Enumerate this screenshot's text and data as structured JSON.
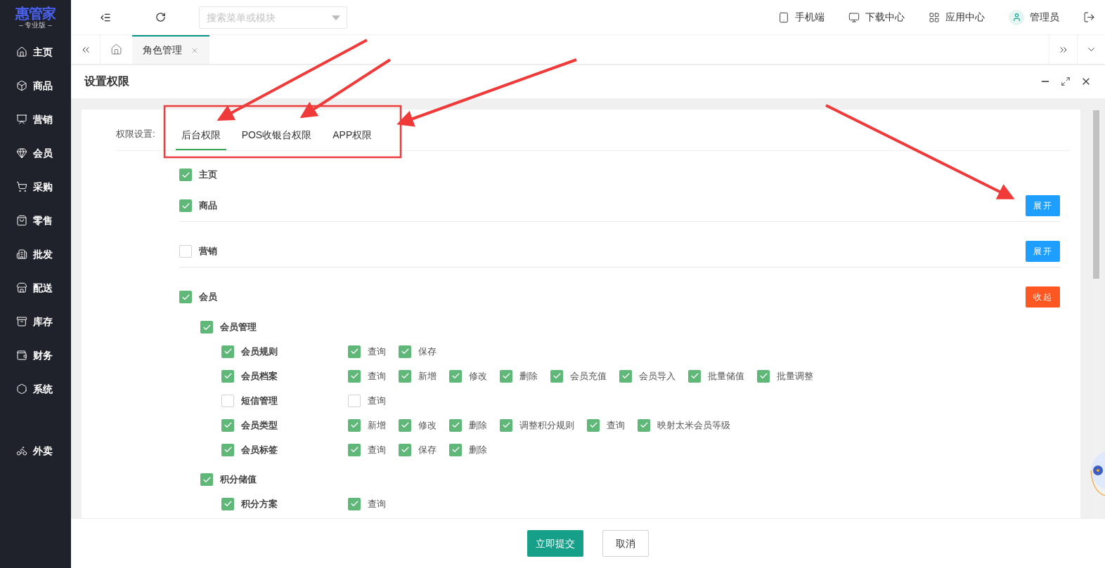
{
  "brand": {
    "name": "惠管家",
    "edition": "– 专业版 –"
  },
  "sidebar": {
    "items": [
      {
        "label": "主页"
      },
      {
        "label": "商品"
      },
      {
        "label": "营销"
      },
      {
        "label": "会员"
      },
      {
        "label": "采购"
      },
      {
        "label": "零售"
      },
      {
        "label": "批发"
      },
      {
        "label": "配送"
      },
      {
        "label": "库存"
      },
      {
        "label": "财务"
      },
      {
        "label": "系统"
      },
      {
        "label": "外卖"
      }
    ]
  },
  "header": {
    "search": {
      "placeholder": "搜索菜单或模块"
    },
    "links": [
      {
        "label": "手机端"
      },
      {
        "label": "下载中心"
      },
      {
        "label": "应用中心"
      },
      {
        "label": "管理员"
      }
    ]
  },
  "page_tabs": [
    {
      "label": "角色管理",
      "selected": true
    }
  ],
  "dialog": {
    "title": "设置权限",
    "field_label": "权限设置:",
    "tabs": [
      {
        "label": "后台权限",
        "selected": true
      },
      {
        "label": "POS收银台权限",
        "selected": false
      },
      {
        "label": "APP权限",
        "selected": false
      }
    ],
    "sections": [
      {
        "label": "主页",
        "checked": true
      },
      {
        "label": "商品",
        "checked": true,
        "toggle": {
          "label": "展开",
          "kind": "expand"
        }
      },
      {
        "label": "营销",
        "checked": false,
        "toggle": {
          "label": "展开",
          "kind": "expand"
        }
      },
      {
        "label": "会员",
        "checked": true,
        "toggle": {
          "label": "收起",
          "kind": "collapse"
        },
        "groups": [
          {
            "label": "会员管理",
            "checked": true,
            "items": [
              {
                "label": "会员规则",
                "checked": true,
                "actions": [
                  {
                    "label": "查询",
                    "checked": true
                  },
                  {
                    "label": "保存",
                    "checked": true
                  }
                ]
              },
              {
                "label": "会员档案",
                "checked": true,
                "actions": [
                  {
                    "label": "查询",
                    "checked": true
                  },
                  {
                    "label": "新增",
                    "checked": true
                  },
                  {
                    "label": "修改",
                    "checked": true
                  },
                  {
                    "label": "删除",
                    "checked": true
                  },
                  {
                    "label": "会员充值",
                    "checked": true
                  },
                  {
                    "label": "会员导入",
                    "checked": true
                  },
                  {
                    "label": "批量储值",
                    "checked": true
                  },
                  {
                    "label": "批量调整",
                    "checked": true
                  }
                ]
              },
              {
                "label": "短信管理",
                "checked": false,
                "actions": [
                  {
                    "label": "查询",
                    "checked": false
                  }
                ]
              },
              {
                "label": "会员类型",
                "checked": true,
                "actions": [
                  {
                    "label": "新增",
                    "checked": true
                  },
                  {
                    "label": "修改",
                    "checked": true
                  },
                  {
                    "label": "删除",
                    "checked": true
                  },
                  {
                    "label": "调整积分规则",
                    "checked": true
                  },
                  {
                    "label": "查询",
                    "checked": true
                  },
                  {
                    "label": "映射太米会员等级",
                    "checked": true
                  }
                ]
              },
              {
                "label": "会员标签",
                "checked": true,
                "actions": [
                  {
                    "label": "查询",
                    "checked": true
                  },
                  {
                    "label": "保存",
                    "checked": true
                  },
                  {
                    "label": "删除",
                    "checked": true
                  }
                ]
              }
            ]
          },
          {
            "label": "积分储值",
            "checked": true,
            "items": [
              {
                "label": "积分方案",
                "checked": true,
                "actions": [
                  {
                    "label": "查询",
                    "checked": true
                  }
                ]
              }
            ]
          }
        ]
      }
    ],
    "buttons": [
      {
        "label": "立即提交",
        "kind": "primary"
      },
      {
        "label": "取消",
        "kind": "secondary"
      }
    ]
  }
}
